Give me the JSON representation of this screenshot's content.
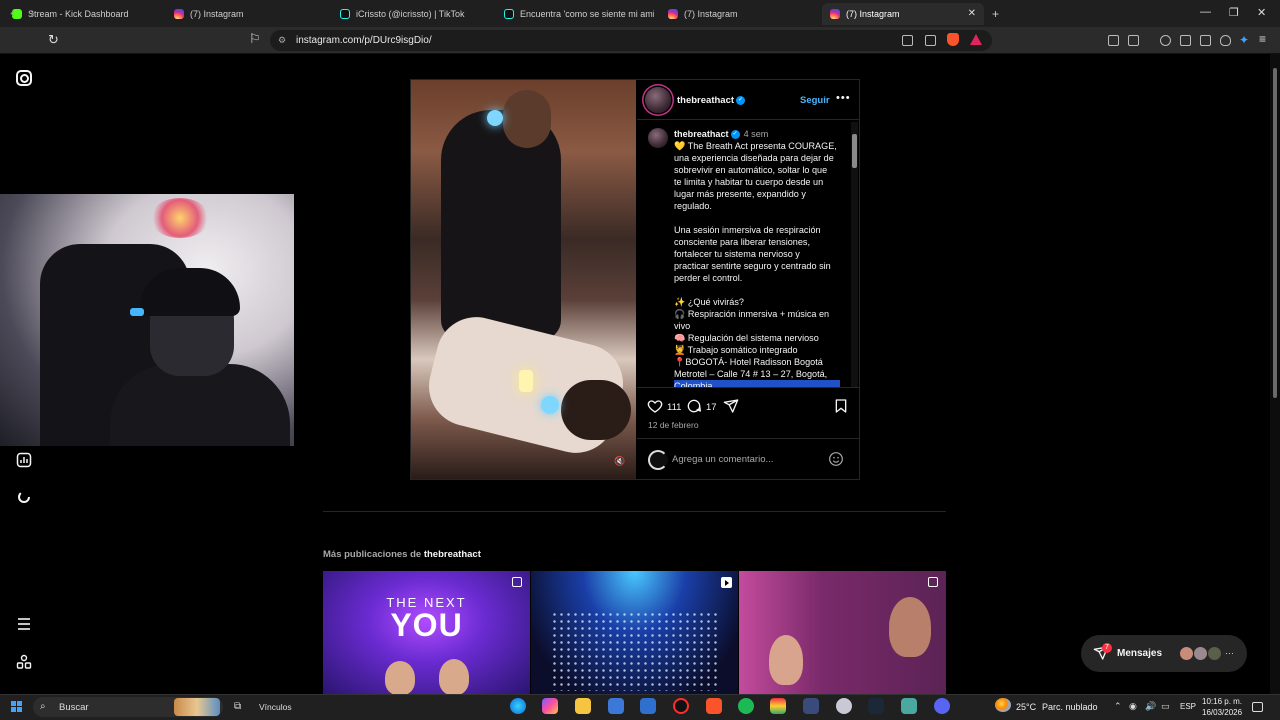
{
  "browser": {
    "tabs": [
      {
        "label": "Stream - Kick Dashboard",
        "favicon": "kick-icon"
      },
      {
        "label": "(7) Instagram",
        "favicon": "instagram-icon"
      },
      {
        "label": "iCrissto (@icrissto) | TikTok",
        "favicon": "tiktok-icon"
      },
      {
        "label": "Encuentra 'como se siente mi amigo",
        "favicon": "tiktok-icon"
      },
      {
        "label": "(7) Instagram",
        "favicon": "instagram-icon"
      },
      {
        "label": "(7) Instagram",
        "favicon": "instagram-icon",
        "active": true
      }
    ],
    "url": "instagram.com/p/DUrc9isgDio/"
  },
  "post": {
    "username": "thebreathact",
    "follow_label": "Seguir",
    "more_label": "•••",
    "caption_time": "4 sem",
    "caption_lines": [
      "💛 The Breath Act presenta COURAGE,",
      "una experiencia diseñada para dejar de",
      "sobrevivir en automático, soltar lo que",
      "te limita y habitar tu cuerpo desde un",
      "lugar más presente, expandido y",
      "regulado.",
      "",
      "Una sesión inmersiva de respiración",
      "consciente para liberar tensiones,",
      "fortalecer tu sistema nervioso y",
      "practicar sentirte seguro y centrado sin",
      "perder el control.",
      "",
      "✨ ¿Qué vivirás?",
      "🎧 Respiración inmersiva + música en",
      "vivo",
      "🧠 Regulación del sistema nervioso",
      "💆 Trabajo somático integrado",
      "📍BOGOTÁ-  Hotel Radisson Bogotá",
      "Metrotel – Calle 74 # 13 – 27, Bogotá,",
      "Colombia"
    ],
    "likes": "111",
    "comments": "17",
    "date": "12 de febrero",
    "comment_placeholder": "Agrega un comentario..."
  },
  "more_posts": {
    "prefix": "Más publicaciones de",
    "username": "thebreathact",
    "thumb1_title_a": "THE NEXT",
    "thumb1_title_b": "YOU"
  },
  "messages": {
    "label": "Mensajes",
    "badge": "7",
    "more": "···"
  },
  "taskbar": {
    "search_label": "Buscar",
    "links_label": "Vínculos",
    "temperature": "25°C",
    "weather": "Parc. nublado",
    "language": "ESP",
    "time": "10:16 p. m.",
    "date": "16/03/2026"
  },
  "colors": {
    "accent": "#0095f6",
    "link": "#4cb5f9",
    "badge": "#ff3040",
    "background": "#000000"
  }
}
